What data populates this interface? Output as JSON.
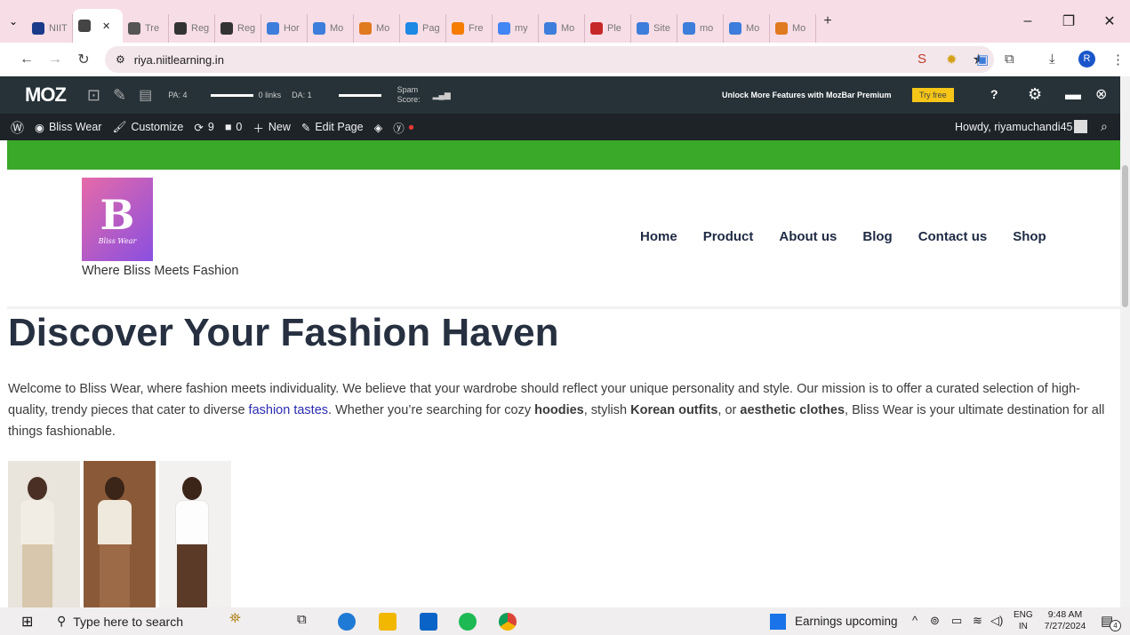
{
  "browser": {
    "tabs": [
      {
        "label": "NIIT",
        "color": "#1a3b8a",
        "active": false
      },
      {
        "label": "",
        "color": "#444",
        "active": true
      },
      {
        "label": "Tre",
        "color": "#555",
        "active": false
      },
      {
        "label": "Reg",
        "color": "#333",
        "active": false
      },
      {
        "label": "Reg",
        "color": "#333",
        "active": false
      },
      {
        "label": "Hor",
        "color": "#3d7ddb",
        "active": false
      },
      {
        "label": "Mo",
        "color": "#3d7ddb",
        "active": false
      },
      {
        "label": "Mo",
        "color": "#e07a1f",
        "active": false
      },
      {
        "label": "Pag",
        "color": "#1e88e5",
        "active": false
      },
      {
        "label": "Fre",
        "color": "#f57c00",
        "active": false
      },
      {
        "label": "my",
        "color": "#4285f4",
        "active": false
      },
      {
        "label": "Mo",
        "color": "#3d7ddb",
        "active": false
      },
      {
        "label": "Ple",
        "color": "#c62828",
        "active": false
      },
      {
        "label": "Site",
        "color": "#3d7ddb",
        "active": false
      },
      {
        "label": "mo",
        "color": "#3d7ddb",
        "active": false
      },
      {
        "label": "Mo",
        "color": "#3d7ddb",
        "active": false
      },
      {
        "label": "Mo",
        "color": "#e07a1f",
        "active": false
      }
    ],
    "new_tab": "+",
    "window_controls": {
      "minimize": "–",
      "restore": "❐",
      "close": "✕"
    },
    "url": "riya.niitlearning.in"
  },
  "mozbar": {
    "logo": "MOZ",
    "pa": "PA: 4",
    "links": "0 links",
    "da": "DA: 1",
    "spam": "Spam Score:",
    "unlock": "Unlock More Features with MozBar Premium",
    "try": "Try free"
  },
  "wpbar": {
    "site": "Bliss Wear",
    "customize": "Customize",
    "updates": "9",
    "comments": "0",
    "new": "New",
    "edit": "Edit Page",
    "howdy": "Howdy, riyamuchandi45"
  },
  "site": {
    "logo_letter": "B",
    "logo_script": "Bliss Wear",
    "tagline": "Where Bliss Meets Fashion",
    "menu": [
      "Home",
      "Product",
      "About us",
      "Blog",
      "Contact us",
      "Shop"
    ],
    "heading": "Discover Your Fashion Haven",
    "para": {
      "p1": "Welcome to Bliss Wear, where fashion meets individuality. We believe that your wardrobe should reflect your unique personality and style. Our mission is to offer a curated selection of high-quality, trendy pieces that cater to diverse ",
      "link": "fashion tastes",
      "p2": ". Whether you’re searching for cozy ",
      "b1": "hoodies",
      "p3": ", stylish ",
      "b2": "Korean outfits",
      "p4": ", or ",
      "b3": "aesthetic clothes",
      "p5": ", Bliss Wear is your ultimate destination for all things fashionable."
    }
  },
  "taskbar": {
    "search_placeholder": "Type here to search",
    "news": "Earnings upcoming",
    "lang": "ENG",
    "region": "IN",
    "time": "9:48 AM",
    "date": "7/27/2024",
    "notif_count": "4"
  }
}
